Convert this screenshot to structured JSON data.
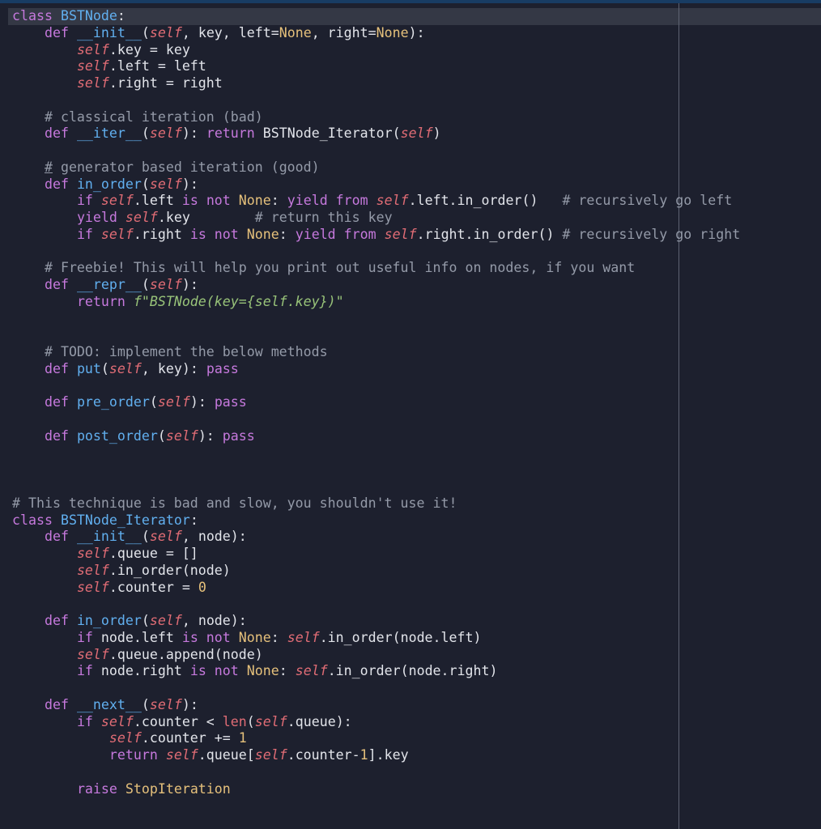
{
  "editor": {
    "colors": {
      "background": "#1d202e",
      "keyword": "#c679dd",
      "function": "#61afef",
      "self": "#e06c75",
      "comment": "#949aa8",
      "constant": "#e5c07b",
      "string": "#98c379",
      "text": "#e2e4ea"
    },
    "lines": [
      [
        [
          "kw",
          "class "
        ],
        [
          "def",
          "BSTNode"
        ],
        [
          "txt",
          ":"
        ]
      ],
      [
        [
          "txt",
          "    "
        ],
        [
          "kw",
          "def "
        ],
        [
          "def",
          "__init__"
        ],
        [
          "txt",
          "("
        ],
        [
          "self",
          "self"
        ],
        [
          "txt",
          ", key, left="
        ],
        [
          "val",
          "None"
        ],
        [
          "txt",
          ", right="
        ],
        [
          "val",
          "None"
        ],
        [
          "txt",
          "):"
        ]
      ],
      [
        [
          "txt",
          "        "
        ],
        [
          "self",
          "self"
        ],
        [
          "txt",
          ".key = key"
        ]
      ],
      [
        [
          "txt",
          "        "
        ],
        [
          "self",
          "self"
        ],
        [
          "txt",
          ".left = left"
        ]
      ],
      [
        [
          "txt",
          "        "
        ],
        [
          "self",
          "self"
        ],
        [
          "txt",
          ".right = right"
        ]
      ],
      [],
      [
        [
          "txt",
          "    "
        ],
        [
          "cmt",
          "# classical iteration (bad)"
        ]
      ],
      [
        [
          "txt",
          "    "
        ],
        [
          "kw",
          "def "
        ],
        [
          "def",
          "__iter__"
        ],
        [
          "txt",
          "("
        ],
        [
          "self",
          "self"
        ],
        [
          "txt",
          "): "
        ],
        [
          "kw",
          "return "
        ],
        [
          "txt",
          "BSTNode_Iterator("
        ],
        [
          "self",
          "self"
        ],
        [
          "txt",
          ")"
        ]
      ],
      [],
      [
        [
          "txt",
          "    "
        ],
        [
          "cmt",
          "# generator based iteration (good)"
        ]
      ],
      [
        [
          "txt",
          "    "
        ],
        [
          "kw",
          "def "
        ],
        [
          "def",
          "in_order"
        ],
        [
          "txt",
          "("
        ],
        [
          "self",
          "self"
        ],
        [
          "txt",
          "):"
        ]
      ],
      [
        [
          "txt",
          "        "
        ],
        [
          "kw",
          "if "
        ],
        [
          "self",
          "self"
        ],
        [
          "txt",
          ".left "
        ],
        [
          "kw",
          "is not "
        ],
        [
          "val",
          "None"
        ],
        [
          "txt",
          ": "
        ],
        [
          "kw",
          "yield from "
        ],
        [
          "self",
          "self"
        ],
        [
          "txt",
          ".left.in_order()   "
        ],
        [
          "cmt",
          "# recursively go left"
        ]
      ],
      [
        [
          "txt",
          "        "
        ],
        [
          "kw",
          "yield "
        ],
        [
          "self",
          "self"
        ],
        [
          "txt",
          ".key        "
        ],
        [
          "cmt",
          "# return this key"
        ]
      ],
      [
        [
          "txt",
          "        "
        ],
        [
          "kw",
          "if "
        ],
        [
          "self",
          "self"
        ],
        [
          "txt",
          ".right "
        ],
        [
          "kw",
          "is not "
        ],
        [
          "val",
          "None"
        ],
        [
          "txt",
          ": "
        ],
        [
          "kw",
          "yield from "
        ],
        [
          "self",
          "self"
        ],
        [
          "txt",
          ".right.in_order() "
        ],
        [
          "cmt",
          "# recursively go right"
        ]
      ],
      [],
      [
        [
          "txt",
          "    "
        ],
        [
          "cmt",
          "# Freebie! This will help you print out useful info on nodes, if you want"
        ]
      ],
      [
        [
          "txt",
          "    "
        ],
        [
          "kw",
          "def "
        ],
        [
          "def",
          "__repr__"
        ],
        [
          "txt",
          "("
        ],
        [
          "self",
          "self"
        ],
        [
          "txt",
          "):"
        ]
      ],
      [
        [
          "txt",
          "        "
        ],
        [
          "kw",
          "return "
        ],
        [
          "str",
          "f\"BSTNode(key={self.key})\""
        ]
      ],
      [],
      [],
      [
        [
          "txt",
          "    "
        ],
        [
          "cmt",
          "# TODO: implement the below methods"
        ]
      ],
      [
        [
          "txt",
          "    "
        ],
        [
          "kw",
          "def "
        ],
        [
          "def",
          "put"
        ],
        [
          "txt",
          "("
        ],
        [
          "self",
          "self"
        ],
        [
          "txt",
          ", key): "
        ],
        [
          "kw",
          "pass"
        ]
      ],
      [],
      [
        [
          "txt",
          "    "
        ],
        [
          "kw",
          "def "
        ],
        [
          "def",
          "pre_order"
        ],
        [
          "txt",
          "("
        ],
        [
          "self",
          "self"
        ],
        [
          "txt",
          "): "
        ],
        [
          "kw",
          "pass"
        ]
      ],
      [],
      [
        [
          "txt",
          "    "
        ],
        [
          "kw",
          "def "
        ],
        [
          "def",
          "post_order"
        ],
        [
          "txt",
          "("
        ],
        [
          "self",
          "self"
        ],
        [
          "txt",
          "): "
        ],
        [
          "kw",
          "pass"
        ]
      ],
      [],
      [],
      [],
      [
        [
          "cmt",
          "# This technique is bad and slow, you shouldn't use it!"
        ]
      ],
      [
        [
          "kw",
          "class "
        ],
        [
          "def",
          "BSTNode_Iterator"
        ],
        [
          "txt",
          ":"
        ]
      ],
      [
        [
          "txt",
          "    "
        ],
        [
          "kw",
          "def "
        ],
        [
          "def",
          "__init__"
        ],
        [
          "txt",
          "("
        ],
        [
          "self",
          "self"
        ],
        [
          "txt",
          ", node):"
        ]
      ],
      [
        [
          "txt",
          "        "
        ],
        [
          "self",
          "self"
        ],
        [
          "txt",
          ".queue = []"
        ]
      ],
      [
        [
          "txt",
          "        "
        ],
        [
          "self",
          "self"
        ],
        [
          "txt",
          ".in_order(node)"
        ]
      ],
      [
        [
          "txt",
          "        "
        ],
        [
          "self",
          "self"
        ],
        [
          "txt",
          ".counter = "
        ],
        [
          "val",
          "0"
        ]
      ],
      [],
      [
        [
          "txt",
          "    "
        ],
        [
          "kw",
          "def "
        ],
        [
          "def",
          "in_order"
        ],
        [
          "txt",
          "("
        ],
        [
          "self",
          "self"
        ],
        [
          "txt",
          ", node):"
        ]
      ],
      [
        [
          "txt",
          "        "
        ],
        [
          "kw",
          "if "
        ],
        [
          "txt",
          "node.left "
        ],
        [
          "kw",
          "is not "
        ],
        [
          "val",
          "None"
        ],
        [
          "txt",
          ": "
        ],
        [
          "self",
          "self"
        ],
        [
          "txt",
          ".in_order(node.left)"
        ]
      ],
      [
        [
          "txt",
          "        "
        ],
        [
          "self",
          "self"
        ],
        [
          "txt",
          ".queue.append(node)"
        ]
      ],
      [
        [
          "txt",
          "        "
        ],
        [
          "kw",
          "if "
        ],
        [
          "txt",
          "node.right "
        ],
        [
          "kw",
          "is not "
        ],
        [
          "val",
          "None"
        ],
        [
          "txt",
          ": "
        ],
        [
          "self",
          "self"
        ],
        [
          "txt",
          ".in_order(node.right)"
        ]
      ],
      [],
      [
        [
          "txt",
          "    "
        ],
        [
          "kw",
          "def "
        ],
        [
          "def",
          "__next__"
        ],
        [
          "txt",
          "("
        ],
        [
          "self",
          "self"
        ],
        [
          "txt",
          "):"
        ]
      ],
      [
        [
          "txt",
          "        "
        ],
        [
          "kw",
          "if "
        ],
        [
          "self",
          "self"
        ],
        [
          "txt",
          ".counter < "
        ],
        [
          "bi",
          "len"
        ],
        [
          "txt",
          "("
        ],
        [
          "self",
          "self"
        ],
        [
          "txt",
          ".queue):"
        ]
      ],
      [
        [
          "txt",
          "            "
        ],
        [
          "self",
          "self"
        ],
        [
          "txt",
          ".counter += "
        ],
        [
          "val",
          "1"
        ]
      ],
      [
        [
          "txt",
          "            "
        ],
        [
          "kw",
          "return "
        ],
        [
          "self",
          "self"
        ],
        [
          "txt",
          ".queue["
        ],
        [
          "self",
          "self"
        ],
        [
          "txt",
          ".counter-"
        ],
        [
          "val",
          "1"
        ],
        [
          "txt",
          "].key"
        ]
      ],
      [],
      [
        [
          "txt",
          "        "
        ],
        [
          "kw",
          "raise "
        ],
        [
          "val",
          "StopIteration"
        ]
      ]
    ]
  }
}
